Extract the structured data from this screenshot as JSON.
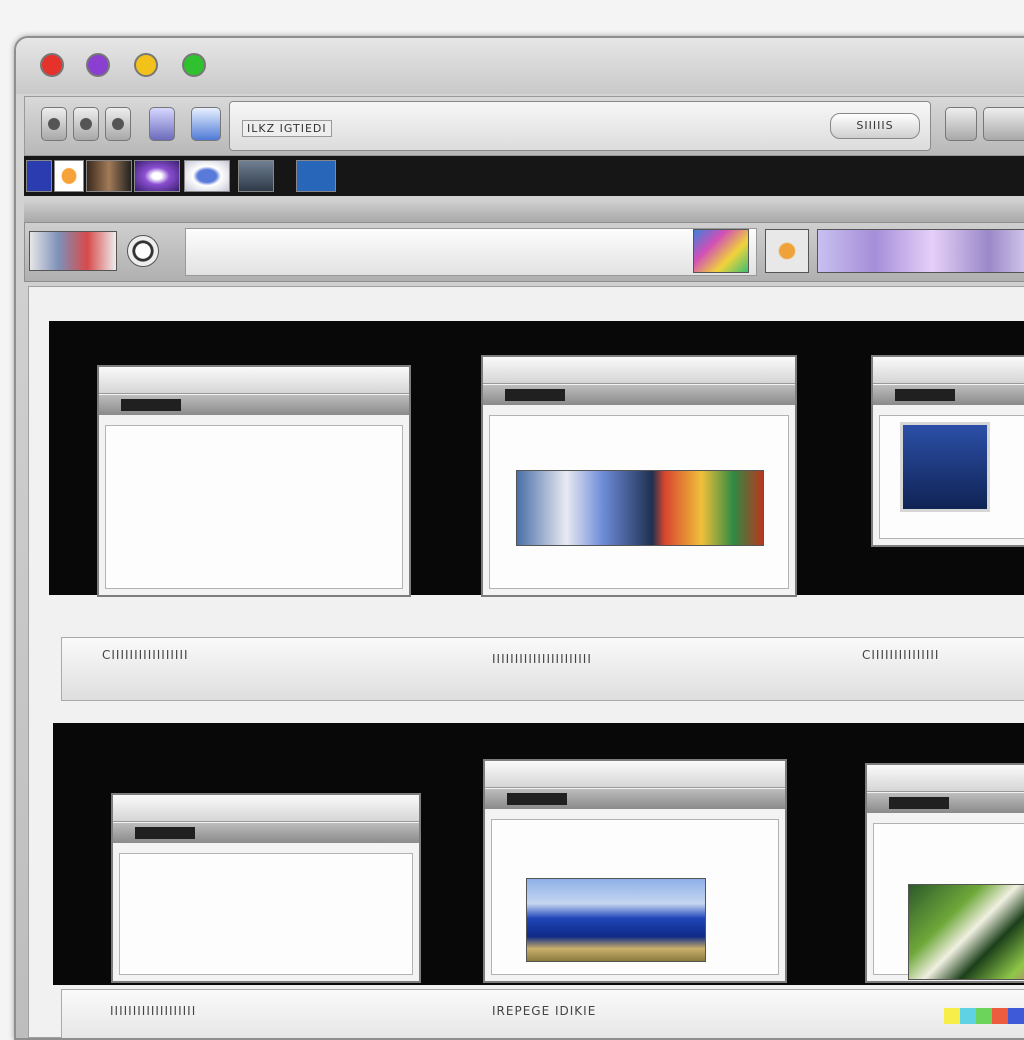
{
  "window": {
    "traffic_lights": [
      "#e5322b",
      "#8b3fd1",
      "#f2c21b",
      "#2fc12f"
    ]
  },
  "toolbar": {
    "address_text": "ILKZ IGTIEDI",
    "address_button": "SIIIIIS"
  },
  "grid": {
    "row1_labels": [
      "CIIIIIIIIIIIIIIIII",
      "IIIIIIIIIIIIIIIIIIIIII",
      "CIIIIIIIIIIIIIII"
    ],
    "row2_labels": [
      "IIIIIIIIIIIIIIIIIII",
      "IREPEGE IDIKIE"
    ]
  },
  "watermark_colors": [
    "#f7ee4a",
    "#5fd3e3",
    "#6cd35b",
    "#ee5c40",
    "#3f5ad8"
  ]
}
